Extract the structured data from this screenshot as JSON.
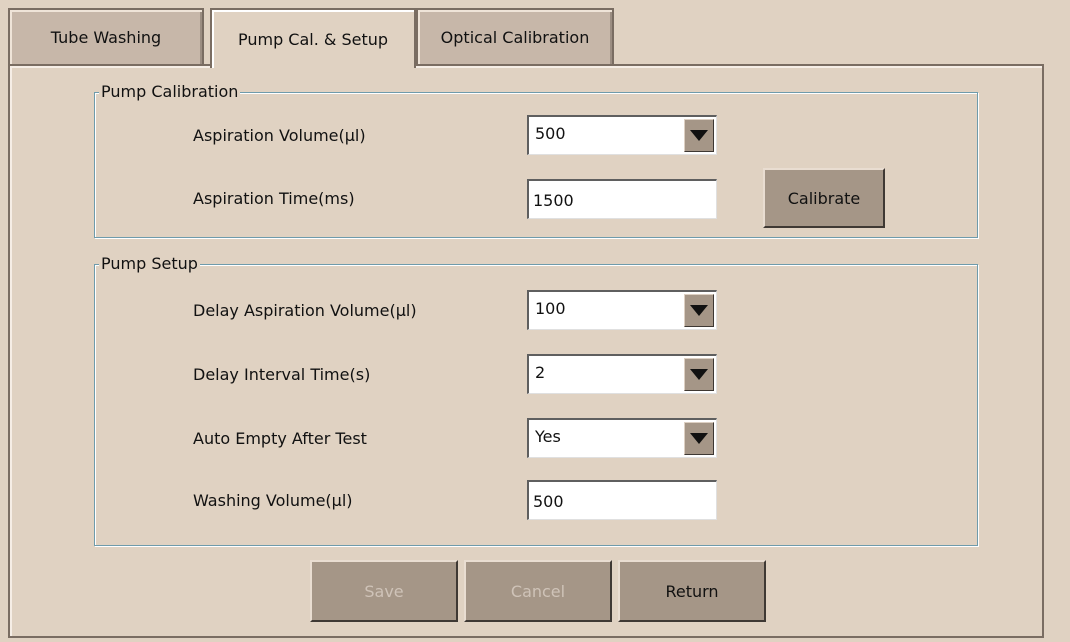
{
  "tabs": [
    {
      "label": "Tube Washing"
    },
    {
      "label": "Pump Cal. & Setup"
    },
    {
      "label": "Optical Calibration"
    }
  ],
  "pump_calibration": {
    "title": "Pump Calibration",
    "aspiration_volume_label": "Aspiration Volume(µl)",
    "aspiration_volume_value": "500",
    "aspiration_time_label": "Aspiration Time(ms)",
    "aspiration_time_value": "1500",
    "calibrate_label": "Calibrate"
  },
  "pump_setup": {
    "title": "Pump Setup",
    "delay_aspiration_volume_label": "Delay Aspiration Volume(µl)",
    "delay_aspiration_volume_value": "100",
    "delay_interval_time_label": "Delay Interval Time(s)",
    "delay_interval_time_value": "2",
    "auto_empty_label": "Auto Empty After Test",
    "auto_empty_value": "Yes",
    "washing_volume_label": "Washing Volume(µl)",
    "washing_volume_value": "500"
  },
  "footer": {
    "save_label": "Save",
    "cancel_label": "Cancel",
    "return_label": "Return"
  },
  "icons": {
    "dropdown": "chevron-down-icon"
  }
}
